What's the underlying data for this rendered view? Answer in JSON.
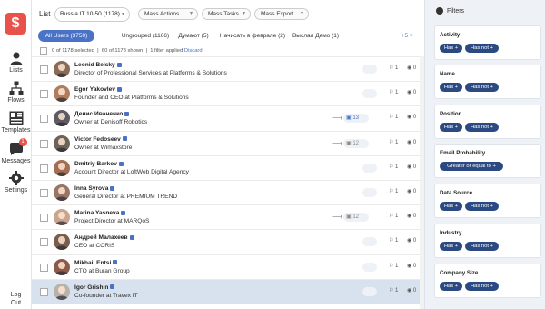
{
  "nav": {
    "logo": "$",
    "items": [
      {
        "label": "Lists"
      },
      {
        "label": "Flows"
      },
      {
        "label": "Templates"
      },
      {
        "label": "Messages",
        "badge": "1"
      },
      {
        "label": "Settings"
      }
    ],
    "logout": [
      "Log",
      "Out"
    ]
  },
  "topbar": {
    "list_label": "List",
    "list_value": "Russia IT 10-50 (1178)",
    "mass_actions": "Mass Actions",
    "mass_tasks": "Mass Tasks",
    "mass_export": "Mass Export"
  },
  "tabs": [
    {
      "label": "All Users (3759)",
      "active": true
    },
    {
      "label": "Ungrouped (1166)"
    },
    {
      "label": "Думают (5)"
    },
    {
      "label": "Начисать в феврале (2)"
    },
    {
      "label": "Выслал Демо (1)"
    },
    {
      "label": "+5 ▾"
    }
  ],
  "infobar": {
    "selected": "0 of 1178 selected",
    "shown": "60 of 1178 shown",
    "filter": "1 filter applied",
    "discard": "Discard"
  },
  "rows": [
    {
      "name": "Leonid Belsky",
      "title": "Director of Professional Services at Platforms & Solutions",
      "share": false,
      "msg": "",
      "c1": "1",
      "c2": "0"
    },
    {
      "name": "Egor Yakovlev",
      "title": "Founder and CEO at Platforms & Solutions",
      "share": false,
      "msg": "",
      "c1": "1",
      "c2": "0"
    },
    {
      "name": "Денис Иваненко",
      "title": "Owner at Denisoff Robotics",
      "share": true,
      "msg": "13",
      "c1": "1",
      "c2": "0"
    },
    {
      "name": "Victor Fedoseev",
      "title": "Owner at Wimaxstore",
      "share": true,
      "msg": "12",
      "c1": "1",
      "c2": "0"
    },
    {
      "name": "Dmitriy Barkov",
      "title": "Account Director at LoftWeb Digital Agency",
      "share": false,
      "msg": "",
      "c1": "1",
      "c2": "0"
    },
    {
      "name": "Inna Syrova",
      "title": "General Director at PREMIUM TREND",
      "share": false,
      "msg": "",
      "c1": "1",
      "c2": "0"
    },
    {
      "name": "Marina Yasneva",
      "title": "Project Director at MARQoS",
      "share": true,
      "msg": "12",
      "c1": "1",
      "c2": "0"
    },
    {
      "name": "Андрей Малахеев",
      "title": "CEO at CORIS",
      "share": false,
      "msg": "",
      "c1": "1",
      "c2": "0"
    },
    {
      "name": "Mikhail Entsi",
      "title": "CTO at Buran Group",
      "share": false,
      "msg": "",
      "c1": "1",
      "c2": "0"
    },
    {
      "name": "Igor Grishin",
      "title": "Co-founder at Travex IT",
      "share": false,
      "msg": "",
      "c1": "1",
      "c2": "0",
      "selected": true
    }
  ],
  "filters": {
    "header": "Filters",
    "cards": [
      {
        "title": "Activity",
        "buttons": [
          "Has +",
          "Has not +"
        ]
      },
      {
        "title": "Name",
        "buttons": [
          "Has +",
          "Has not +"
        ]
      },
      {
        "title": "Position",
        "buttons": [
          "Has +",
          "Has not +"
        ]
      },
      {
        "title": "Email Probability",
        "buttons": [
          "Greater or equal to +"
        ]
      },
      {
        "title": "Data Source",
        "buttons": [
          "Has +",
          "Has not +"
        ]
      },
      {
        "title": "Industry",
        "buttons": [
          "Has +",
          "Has not +"
        ]
      },
      {
        "title": "Company Size",
        "buttons": [
          "Has +",
          "Has not +"
        ]
      }
    ]
  },
  "colors": {
    "accent": "#4a73c7",
    "brand": "#e8524a",
    "filter_button": "#2c4a82"
  }
}
